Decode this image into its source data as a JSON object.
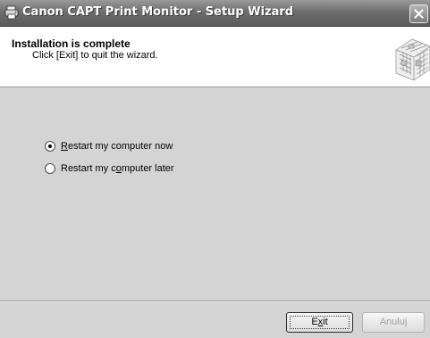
{
  "window": {
    "title": "Canon CAPT Print Monitor - Setup Wizard"
  },
  "header": {
    "title": "Installation is complete",
    "subtitle": "Click [Exit] to quit the wizard."
  },
  "options": [
    {
      "label_pre": "",
      "label_key": "R",
      "label_post": "estart my computer now",
      "selected": true
    },
    {
      "label_pre": "Restart my c",
      "label_key": "o",
      "label_post": "mputer later",
      "selected": false
    }
  ],
  "buttons": {
    "exit_pre": "E",
    "exit_key": "x",
    "exit_post": "it",
    "cancel": "Anuluj"
  },
  "icons": {
    "app": "printer-icon",
    "close": "close-icon",
    "header": "wizard-graphic-icon"
  }
}
